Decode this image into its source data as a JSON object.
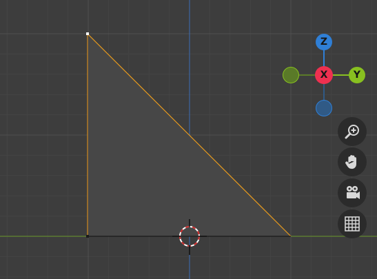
{
  "viewport": {
    "background": "#3d3d3d",
    "grid_minor_color": "#444444",
    "grid_major_color": "#505050",
    "x_axis_color": "#6a9a2a",
    "z_axis_color": "#3b6db5",
    "edge_color": "#e89b1d",
    "selected_vertex_color": "#ffffff",
    "face_fill": "#4a4a4a"
  },
  "nav_gizmo": {
    "z_label": "Z",
    "x_label": "X",
    "y_label": "Y",
    "z_color": "#2f7fd6",
    "x_color": "#ee3050",
    "y_color": "#88c020",
    "neg_y_color": "#5a7a28",
    "neg_z_color": "#305a86"
  },
  "tools": [
    {
      "icon": "zoom-icon"
    },
    {
      "icon": "hand-icon"
    },
    {
      "icon": "camera-icon"
    },
    {
      "icon": "grid-icon"
    }
  ]
}
